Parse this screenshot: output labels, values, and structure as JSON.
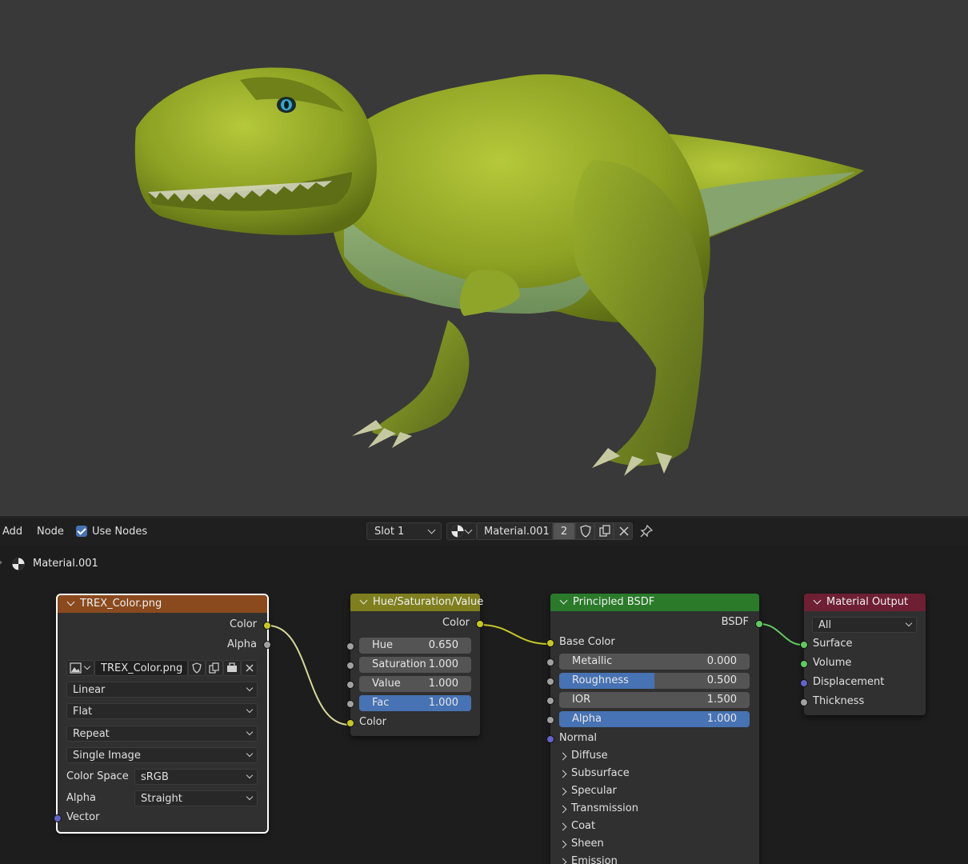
{
  "header": {
    "menu": [
      "Add",
      "Node"
    ],
    "use_nodes_label": "Use Nodes",
    "slot_label": "Slot 1",
    "material_name": "Material.001",
    "user_count": "2"
  },
  "breadcrumb": {
    "material": "Material.001"
  },
  "nodes": {
    "image_texture": {
      "title": "TREX_Color.png",
      "header_color": "#8a4a1e",
      "outputs": [
        "Color",
        "Alpha"
      ],
      "image_name": "TREX_Color.png",
      "interpolation": "Linear",
      "projection": "Flat",
      "extension": "Repeat",
      "source": "Single Image",
      "color_space_label": "Color Space",
      "color_space_value": "sRGB",
      "alpha_label": "Alpha",
      "alpha_value": "Straight",
      "input": "Vector"
    },
    "hsv": {
      "title": "Hue/Saturation/Value",
      "header_color": "#7f7f1f",
      "output": "Color",
      "fields": [
        {
          "label": "Hue",
          "value": "0.650",
          "fill": 0
        },
        {
          "label": "Saturation",
          "value": "1.000",
          "fill": 0
        },
        {
          "label": "Value",
          "value": "1.000",
          "fill": 0
        },
        {
          "label": "Fac",
          "value": "1.000",
          "fill": 1
        }
      ],
      "input": "Color"
    },
    "bsdf": {
      "title": "Principled BSDF",
      "header_color": "#2a7a2a",
      "output": "BSDF",
      "base_color": "Base Color",
      "fields": [
        {
          "label": "Metallic",
          "value": "0.000",
          "fill": 0
        },
        {
          "label": "Roughness",
          "value": "0.500",
          "fill": 0.5
        },
        {
          "label": "IOR",
          "value": "1.500",
          "fill": 0
        },
        {
          "label": "Alpha",
          "value": "1.000",
          "fill": 1
        }
      ],
      "normal": "Normal",
      "panels": [
        "Diffuse",
        "Subsurface",
        "Specular",
        "Transmission",
        "Coat",
        "Sheen",
        "Emission"
      ]
    },
    "output": {
      "title": "Material Output",
      "header_color": "#6e1f33",
      "target": "All",
      "inputs": [
        "Surface",
        "Volume",
        "Displacement",
        "Thickness"
      ]
    }
  }
}
